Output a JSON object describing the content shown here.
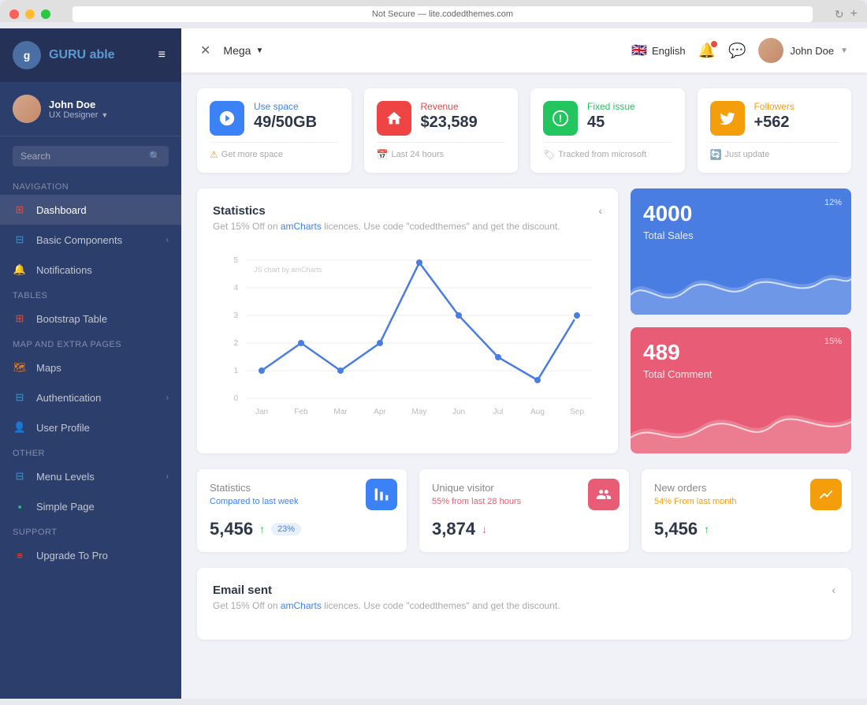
{
  "browser": {
    "url": "Not Secure — lite.codedthemes.com"
  },
  "sidebar": {
    "logo": {
      "brand": "GURU",
      "sub": "able",
      "icon_text": "g"
    },
    "user": {
      "name": "John Doe",
      "role": "UX Designer"
    },
    "search_placeholder": "Search",
    "sections": [
      {
        "label": "Navigation",
        "items": [
          {
            "id": "dashboard",
            "label": "Dashboard",
            "icon": "⊞",
            "active": true,
            "arrow": false
          },
          {
            "id": "basic-components",
            "label": "Basic Components",
            "icon": "⊟",
            "active": false,
            "arrow": true
          },
          {
            "id": "notifications",
            "label": "Notifications",
            "icon": "🔔",
            "active": false,
            "arrow": false
          }
        ]
      },
      {
        "label": "Tables",
        "items": [
          {
            "id": "bootstrap-table",
            "label": "Bootstrap Table",
            "icon": "⊞",
            "active": false,
            "arrow": false
          }
        ]
      },
      {
        "label": "Map And Extra Pages",
        "items": [
          {
            "id": "maps",
            "label": "Maps",
            "icon": "🗺",
            "active": false,
            "arrow": false
          },
          {
            "id": "authentication",
            "label": "Authentication",
            "icon": "⊟",
            "active": false,
            "arrow": true
          },
          {
            "id": "user-profile",
            "label": "User Profile",
            "icon": "👤",
            "active": false,
            "arrow": false
          }
        ]
      },
      {
        "label": "Other",
        "items": [
          {
            "id": "menu-levels",
            "label": "Menu Levels",
            "icon": "⊟",
            "active": false,
            "arrow": true
          },
          {
            "id": "simple-page",
            "label": "Simple Page",
            "icon": "▪",
            "active": false,
            "arrow": false
          }
        ]
      },
      {
        "label": "Support",
        "items": [
          {
            "id": "upgrade-pro",
            "label": "Upgrade To Pro",
            "icon": "≡",
            "active": false,
            "arrow": false
          }
        ]
      }
    ]
  },
  "header": {
    "toggle_label": "☰",
    "mega_label": "Mega",
    "language": "English",
    "username": "John Doe"
  },
  "stat_cards": [
    {
      "id": "use-space",
      "icon": "◉",
      "icon_class": "stat-icon-blue",
      "label": "Use space",
      "label_class": "blue",
      "value": "49/50GB",
      "footer_icon": "⚠",
      "footer_text": "Get more space"
    },
    {
      "id": "revenue",
      "icon": "🏠",
      "icon_class": "stat-icon-red",
      "label": "Revenue",
      "label_class": "red",
      "value": "$23,589",
      "footer_icon": "📅",
      "footer_text": "Last 24 hours"
    },
    {
      "id": "fixed-issue",
      "icon": "❗",
      "icon_class": "stat-icon-green",
      "label": "Fixed issue",
      "label_class": "green",
      "value": "45",
      "footer_icon": "🏷",
      "footer_text": "Tracked from microsoft"
    },
    {
      "id": "followers",
      "icon": "🐦",
      "icon_class": "stat-icon-yellow",
      "label": "Followers",
      "label_class": "yellow",
      "value": "+562",
      "footer_icon": "🔄",
      "footer_text": "Just update"
    }
  ],
  "statistics_chart": {
    "title": "Statistics",
    "subtitle": "Get 15% Off on amCharts licences. Use code \"codedthemes\" and get the discount.",
    "x_labels": [
      "Jan",
      "Feb",
      "Mar",
      "Apr",
      "May",
      "Jun",
      "Jul",
      "Aug",
      "Sep"
    ],
    "y_labels": [
      "0",
      "1",
      "2",
      "3",
      "4",
      "5"
    ],
    "js_label": "JS chart by amCharts"
  },
  "mini_stats": [
    {
      "id": "total-sales",
      "value": "4000",
      "label": "Total Sales",
      "percent": "12%",
      "color_class": "mini-stat-blue"
    },
    {
      "id": "total-comment",
      "value": "489",
      "label": "Total Comment",
      "percent": "15%",
      "color_class": "mini-stat-red"
    }
  ],
  "bottom_cards": [
    {
      "id": "statistics-week",
      "title": "Statistics",
      "subtitle": "Compared to last week",
      "subtitle_class": "",
      "value": "5,456",
      "arrow": "up",
      "badge": "23%",
      "icon": "🖥",
      "icon_class": "bc-icon-blue"
    },
    {
      "id": "unique-visitor",
      "title": "Unique visitor",
      "subtitle": "55% from last 28 hours",
      "subtitle_class": "red",
      "value": "3,874",
      "arrow": "down",
      "badge": null,
      "icon": "👥",
      "icon_class": "bc-icon-red"
    },
    {
      "id": "new-orders",
      "title": "New orders",
      "subtitle": "54% From last month",
      "subtitle_class": "yellow",
      "value": "5,456",
      "arrow": "up",
      "badge": null,
      "icon": "📊",
      "icon_class": "bc-icon-yellow"
    }
  ],
  "email_card": {
    "title": "Email sent",
    "subtitle": "Get 15% Off on amCharts licences. Use code \"codedthemes\" and get the discount."
  }
}
